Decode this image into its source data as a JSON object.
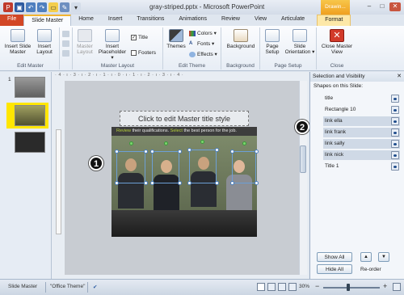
{
  "window": {
    "title": "gray-striped.pptx - Microsoft PowerPoint",
    "context_tab": "Drawin...",
    "min": "–",
    "max": "□",
    "close": "✕"
  },
  "tabs": [
    {
      "label": "File"
    },
    {
      "label": "Slide Master"
    },
    {
      "label": "Home"
    },
    {
      "label": "Insert"
    },
    {
      "label": "Transitions"
    },
    {
      "label": "Animations"
    },
    {
      "label": "Review"
    },
    {
      "label": "View"
    },
    {
      "label": "Articulate"
    },
    {
      "label": "Format"
    }
  ],
  "ribbon": {
    "groups": {
      "edit_master": "Edit Master",
      "master_layout": "Master Layout",
      "edit_theme": "Edit Theme",
      "background": "Background",
      "page_setup": "Page Setup",
      "close": "Close"
    },
    "insert_slide_master": "Insert Slide Master",
    "insert_layout": "Insert Layout",
    "master_layout": "Master Layout",
    "insert_placeholder": "Insert Placeholder ▾",
    "title_check": "Title",
    "footers_check": "Footers",
    "themes": "Themes",
    "colors": "Colors ▾",
    "fonts": "Fonts ▾",
    "effects": "Effects ▾",
    "background_btn": "Background",
    "page_setup_btn": "Page Setup",
    "slide_orientation": "Slide Orientation ▾",
    "close_master_view": "Close Master View"
  },
  "slides": {
    "numbers": [
      "1",
      "",
      ""
    ]
  },
  "ruler": "· 4 · ı · 3 · ı · 2 · ı · 1 · ı · 0 · ı · 1 · ı · 2 · ı · 3 · ı · 4 ·",
  "slide": {
    "title_placeholder": "Click to edit Master title style",
    "banner_1": "Review",
    "banner_2": " their qualifications. ",
    "banner_3": "Select",
    "banner_4": " the best person for the job."
  },
  "callouts": {
    "one": "1",
    "two": "2"
  },
  "pane": {
    "title": "Selection and Visibility",
    "close": "✕",
    "subtitle": "Shapes on this Slide:",
    "shapes": [
      "title",
      "Rectangle 10",
      "link ella",
      "link frank",
      "link sally",
      "link nick",
      "Title 1"
    ],
    "show_all": "Show All",
    "hide_all": "Hide All",
    "reorder": "Re-order",
    "up": "▲",
    "down": "▼"
  },
  "status": {
    "view": "Slide Master",
    "theme": "\"Office Theme\"",
    "zoom": "30%",
    "minus": "−",
    "plus": "+"
  }
}
